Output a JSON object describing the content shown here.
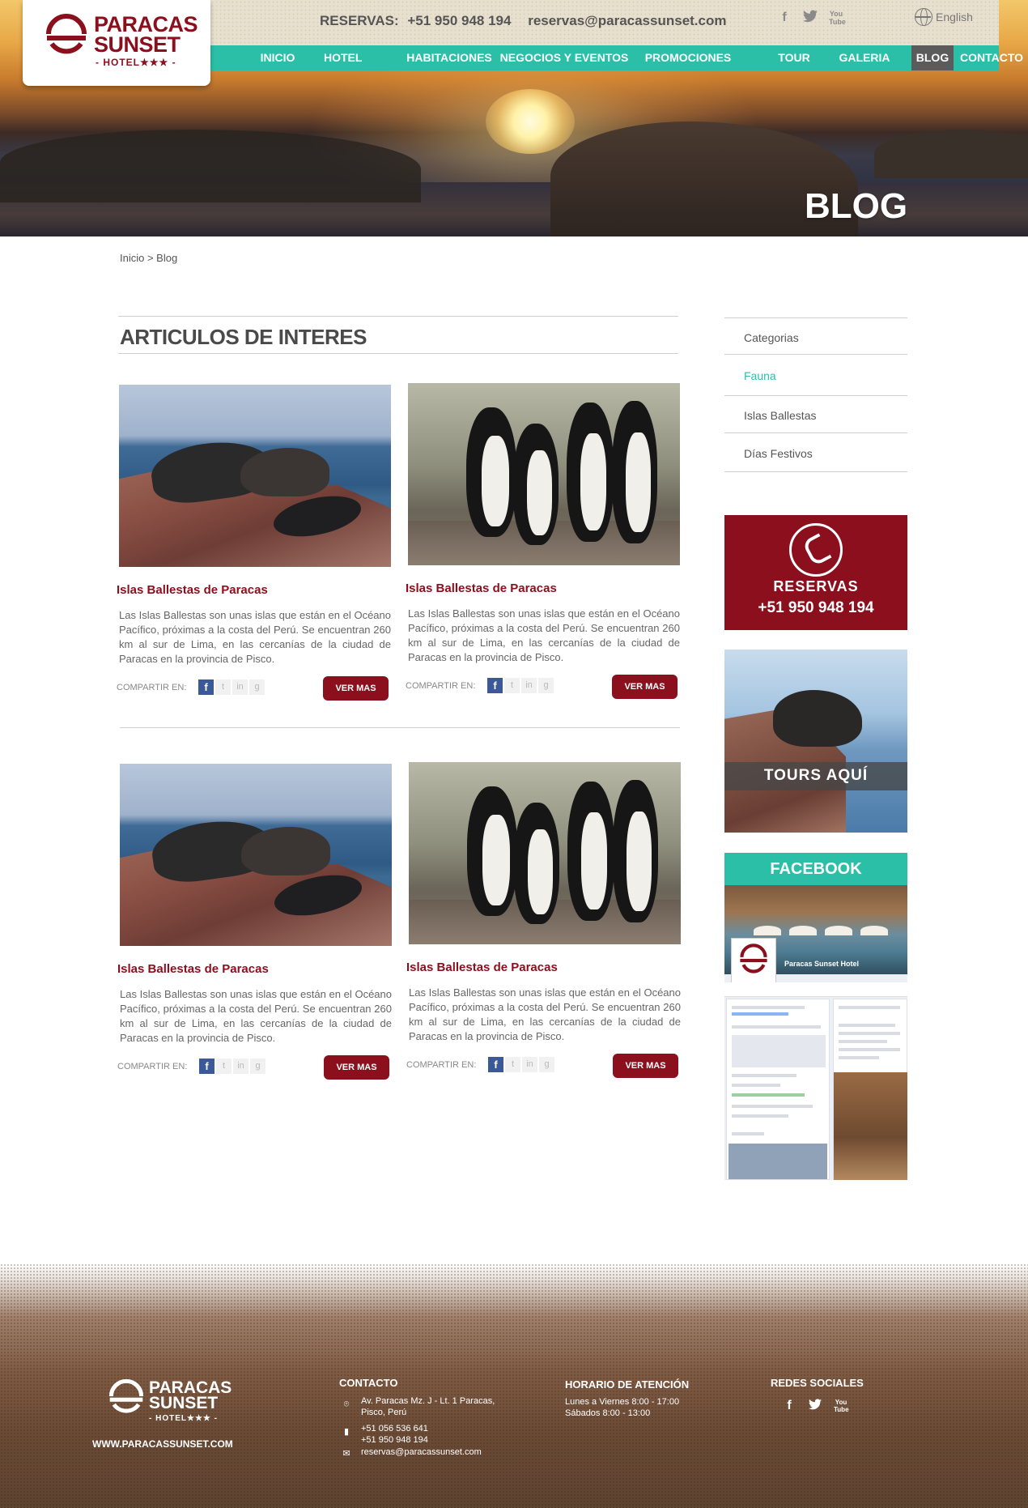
{
  "header": {
    "reservas_label": "RESERVAS:",
    "phone": "+51 950 948 194",
    "email": "reservas@paracassunset.com",
    "social_icons": [
      "facebook-icon",
      "twitter-icon",
      "youtube-icon"
    ],
    "language": "English"
  },
  "logo": {
    "line1": "PARACAS",
    "line2": "SUNSET",
    "sub": "- HOTEL★★★ -"
  },
  "nav": {
    "items": [
      {
        "label": "INICIO",
        "active": false
      },
      {
        "label": "HOTEL",
        "active": false
      },
      {
        "label": "HABITACIONES",
        "active": false
      },
      {
        "label": "NEGOCIOS Y EVENTOS",
        "active": false
      },
      {
        "label": "PROMOCIONES",
        "active": false
      },
      {
        "label": "TOUR",
        "active": false
      },
      {
        "label": "GALERIA",
        "active": false
      },
      {
        "label": "BLOG",
        "active": true
      },
      {
        "label": "CONTACTO",
        "active": false
      }
    ]
  },
  "hero": {
    "title": "BLOG"
  },
  "breadcrumb": "Inicio > Blog",
  "main": {
    "section_title": "ARTICULOS DE INTERES",
    "articles": [
      {
        "image": "sea-lions",
        "title": "Islas Ballestas de Paracas",
        "desc": "Las Islas Ballestas son unas islas que están en el Océano Pacífico, próximas a la costa del Perú. Se encuentran 260 km al sur de Lima, en las cercanías de la ciudad de Paracas en la provincia de Pisco.",
        "share_label": "COMPARTIR EN:",
        "button": "VER MAS"
      },
      {
        "image": "penguins",
        "title": "Islas Ballestas de Paracas",
        "desc": "Las Islas Ballestas son unas islas que están en el Océano Pacífico, próximas a la costa del Perú. Se encuentran 260 km al sur de Lima, en las cercanías de la ciudad de Paracas en la provincia de Pisco.",
        "share_label": "COMPARTIR EN:",
        "button": "VER MAS"
      },
      {
        "image": "sea-lions",
        "title": "Islas Ballestas de Paracas",
        "desc": "Las Islas Ballestas son unas islas que están en el Océano Pacífico, próximas a la costa del Perú. Se encuentran 260 km al sur de Lima, en las cercanías de la ciudad de Paracas en la provincia de Pisco.",
        "share_label": "COMPARTIR EN:",
        "button": "VER MAS"
      },
      {
        "image": "penguins",
        "title": "Islas Ballestas de Paracas",
        "desc": "Las Islas Ballestas son unas islas que están en el Océano Pacífico, próximas a la costa del Perú. Se encuentran 260 km al sur de Lima, en las cercanías de la ciudad de Paracas en la provincia de Pisco.",
        "share_label": "COMPARTIR EN:",
        "button": "VER MAS"
      }
    ]
  },
  "sidebar": {
    "categories_title": "Categorias",
    "categories": [
      {
        "label": "Fauna",
        "active": true
      },
      {
        "label": "Islas Ballestas",
        "active": false
      },
      {
        "label": "Días Festivos",
        "active": false
      }
    ],
    "reservas_label": "RESERVAS",
    "reservas_phone": "+51 950 948 194",
    "tours_label": "TOURS AQUÍ",
    "facebook_label": "FACEBOOK",
    "facebook_page_name": "Paracas Sunset Hotel"
  },
  "footer": {
    "logo_line1": "PARACAS",
    "logo_line2": "SUNSET",
    "logo_sub": "- HOTEL★★★ -",
    "website": "WWW.PARACASSUNSET.COM",
    "contact_title": "CONTACTO",
    "address_1": "Av. Paracas Mz. J - Lt. 1 Paracas,",
    "address_2": "Pisco, Perú",
    "phone_1": "+51 056 536 641",
    "phone_2": "+51 950 948 194",
    "email": "reservas@paracassunset.com",
    "hours_title": "HORARIO DE ATENCIÓN",
    "hours_1": "Lunes a Viernes 8:00 - 17:00",
    "hours_2": "Sábados 8:00  - 13:00",
    "social_title": "REDES SOCIALES"
  },
  "colors": {
    "brand_red": "#8b0f1d",
    "accent_teal": "#2bbfa8",
    "nav_active": "#5b5b5b"
  }
}
